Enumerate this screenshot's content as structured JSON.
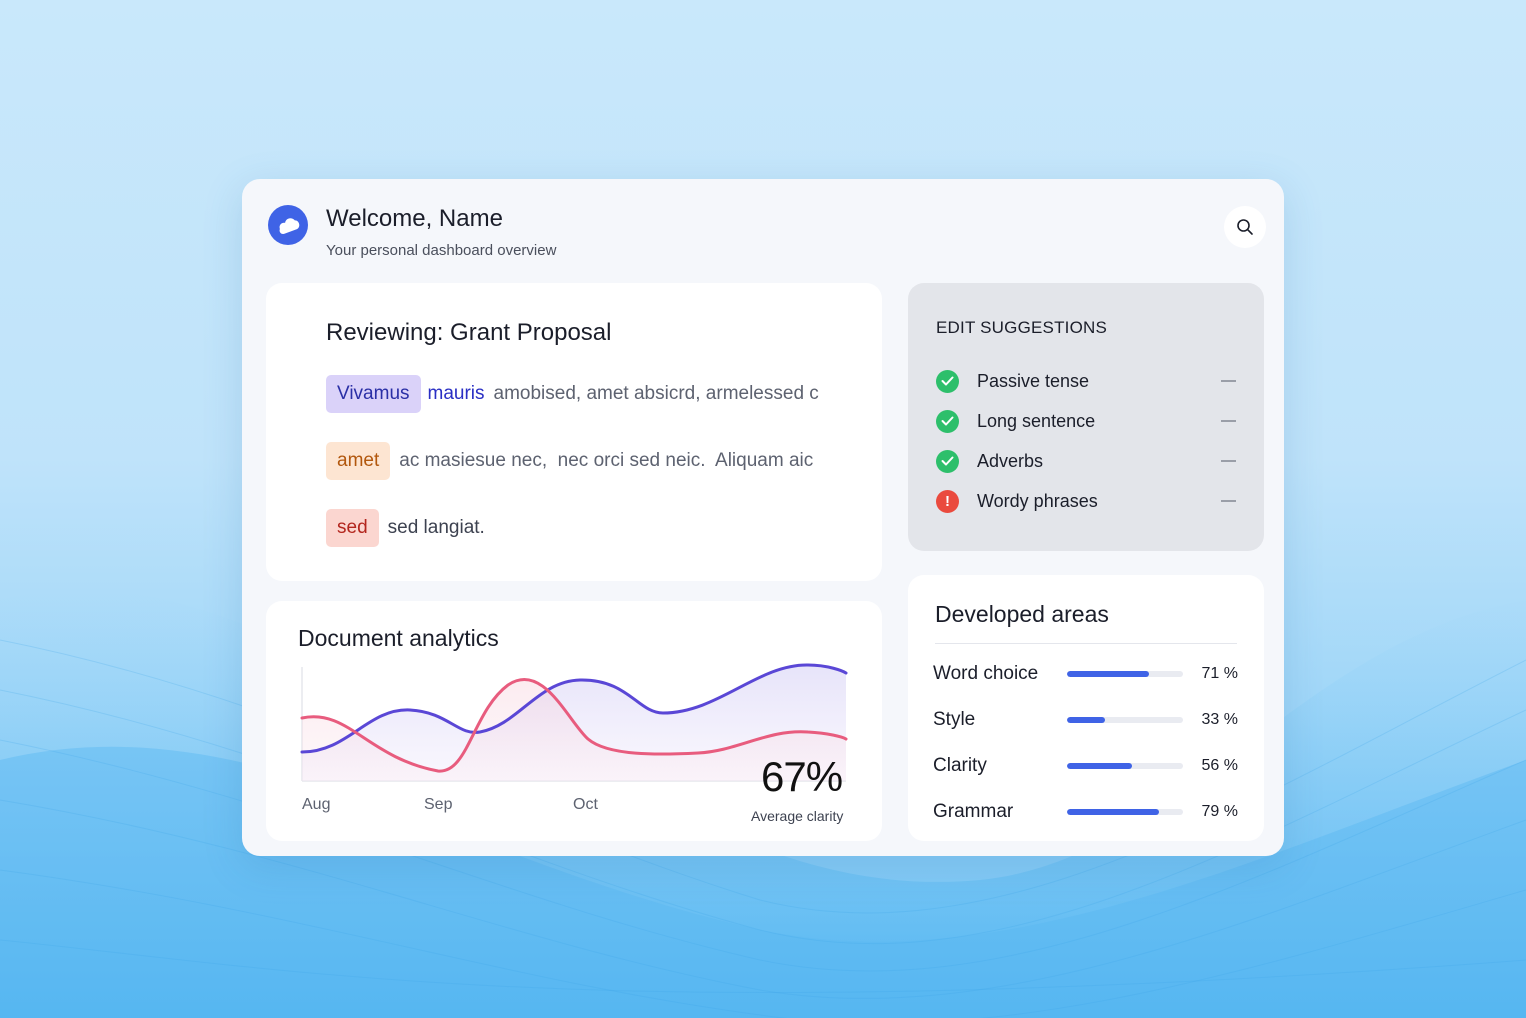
{
  "header": {
    "title": "Welcome, Name",
    "subtitle": "Your personal dashboard overview"
  },
  "review": {
    "title": "Reviewing: Grant Proposal",
    "lines": [
      {
        "tag": "Vivamus",
        "link": "mauris",
        "text": "amobised, amet absicrd, armelessed c"
      },
      {
        "tag": "amet",
        "text": "ac masiesue nec,  nec orci sed neic.  Aliquam aic"
      },
      {
        "tag": "sed",
        "text": "sed langiat."
      }
    ]
  },
  "suggestions": {
    "title": "EDIT SUGGESTIONS",
    "items": [
      {
        "label": "Passive tense",
        "status": "ok"
      },
      {
        "label": "Long sentence",
        "status": "ok"
      },
      {
        "label": "Adverbs",
        "status": "ok"
      },
      {
        "label": "Wordy phrases",
        "status": "warning",
        "icon_text": "!"
      }
    ]
  },
  "analytics": {
    "title": "Document analytics",
    "stat_value": "67%",
    "stat_label": "Average clarity"
  },
  "chart_data": {
    "type": "line",
    "categories": [
      "Aug",
      "Sep",
      "Oct"
    ],
    "series": [
      {
        "color": "#5a47d6"
      },
      {
        "color": "#e85c7e"
      }
    ],
    "grid": false
  },
  "areas": {
    "title": "Developed areas",
    "items": [
      {
        "label": "Word choice",
        "value": 71,
        "pct": "71 %"
      },
      {
        "label": "Style",
        "value": 33,
        "pct": "33 %"
      },
      {
        "label": "Clarity",
        "value": 56,
        "pct": "56 %"
      },
      {
        "label": "Grammar",
        "value": 79,
        "pct": "79 %"
      }
    ]
  },
  "colors": {
    "accent": "#3f63e6",
    "success": "#2dbf6b",
    "danger": "#ea4a3e"
  },
  "icons": {
    "logo": "cloud-logo-icon",
    "search": "search-icon",
    "ok": "check-circle-icon",
    "warning": "alert-circle-icon",
    "collapse": "minus-icon"
  }
}
